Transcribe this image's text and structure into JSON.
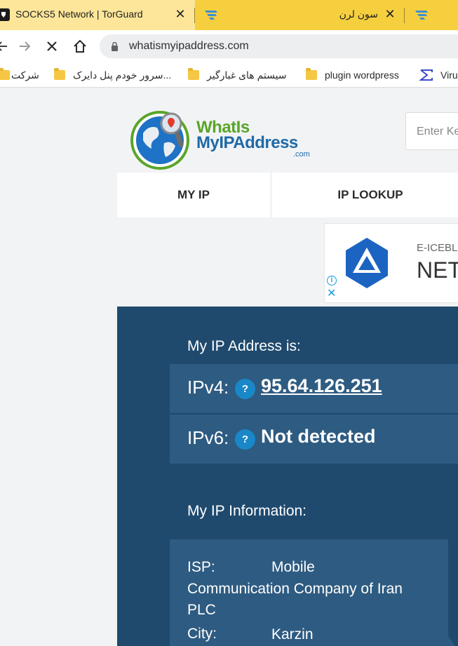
{
  "browser": {
    "tabs": [
      {
        "title": "SOCKS5 Network | TorGuard",
        "close": "✕"
      },
      {
        "title": "سون لرن",
        "close": "✕"
      }
    ],
    "url": "whatismyipaddress.com",
    "bookmarks": [
      {
        "label": "شرکت"
      },
      {
        "label": "سرور خودم پنل دایرک..."
      },
      {
        "label": "سیستم های غبارگیر"
      },
      {
        "label": "plugin wordpress"
      },
      {
        "label": "Viru"
      }
    ]
  },
  "site": {
    "logo": {
      "line1": "WhatIs",
      "line2": "MyIPAddress",
      "line3": ".com"
    },
    "search_placeholder": "Enter Ke",
    "nav": [
      {
        "label": "MY IP"
      },
      {
        "label": "IP LOOKUP"
      }
    ],
    "ad": {
      "brand": "E-ICEBL",
      "name": "NET",
      "info_icon": "i",
      "close_icon": "✕"
    },
    "my_ip_title": "My IP Address is:",
    "ipv4": {
      "label": "IPv4:",
      "help": "?",
      "value": "95.64.126.251"
    },
    "ipv6": {
      "label": "IPv6:",
      "help": "?",
      "value": "Not detected"
    },
    "info_title": "My IP Information:",
    "info": {
      "isp_label": "ISP:",
      "isp_value_line1": "Mobile",
      "isp_value_line2": "Communication Company of Iran",
      "isp_value_line3": "PLC",
      "city_label": "City:",
      "city_value": "Karzin"
    }
  },
  "colors": {
    "tabstrip": "#f5cf3e",
    "panel": "#1f4a6e",
    "row": "#2e5b81",
    "help_badge": "#1a88c8"
  }
}
